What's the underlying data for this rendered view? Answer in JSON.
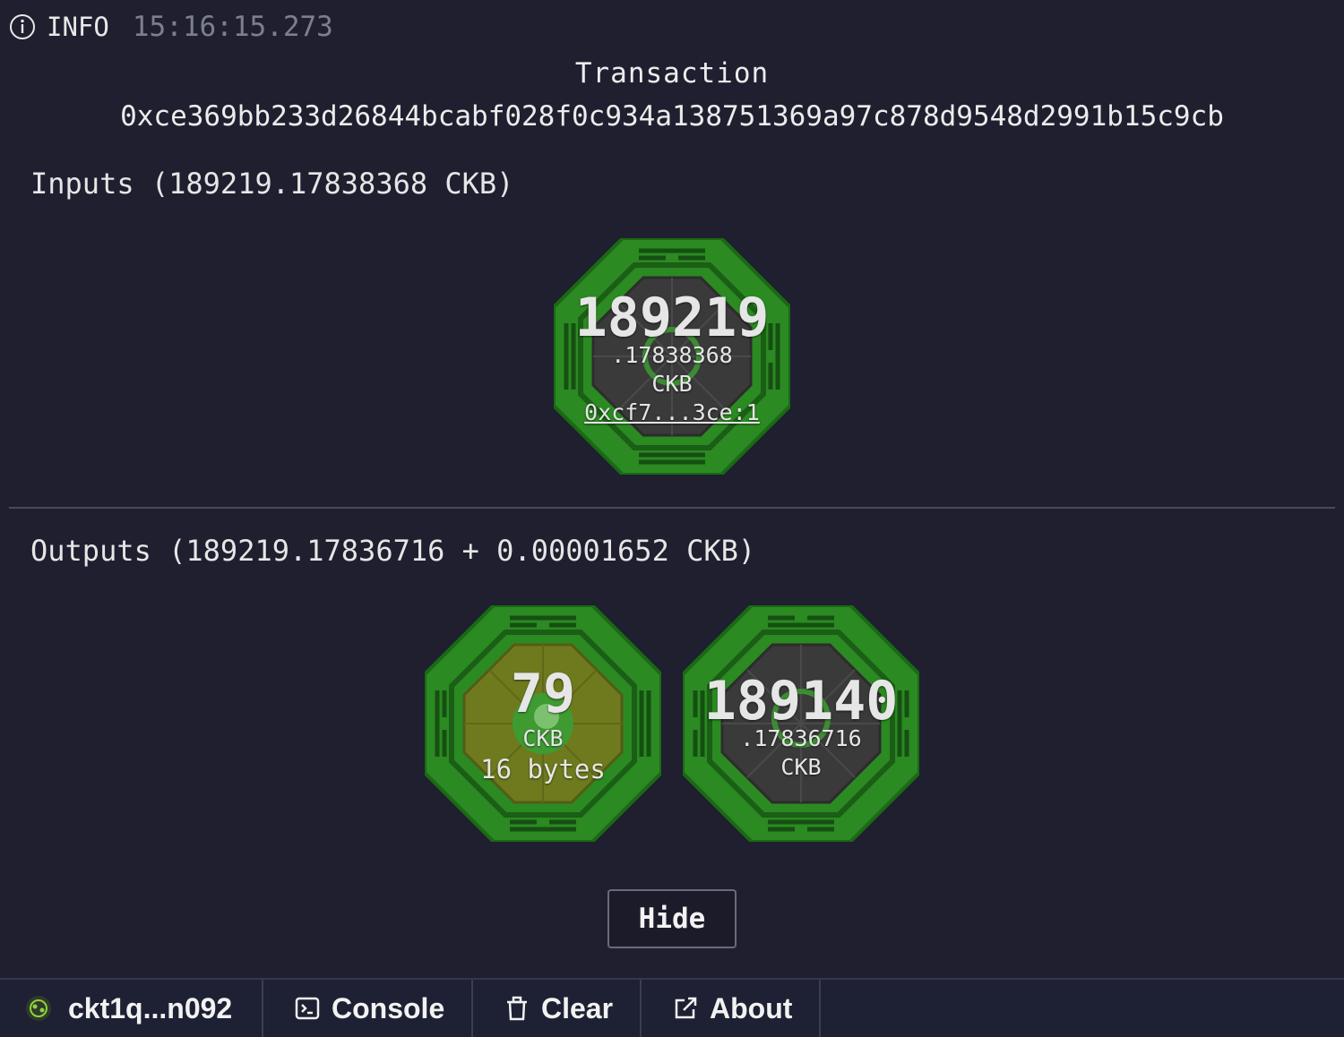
{
  "log": {
    "level": "INFO",
    "time": "15:16:15.273",
    "icon": "info-icon"
  },
  "transaction": {
    "title": "Transaction",
    "hash": "0xce369bb233d26844bcabf028f0c934a138751369a97c878d9548d2991b15c9cb"
  },
  "inputs": {
    "heading": "Inputs (189219.17838368 CKB)",
    "cells": [
      {
        "integer": "189219",
        "fraction": ".17838368",
        "unit": "CKB",
        "outpoint": "0xcf7...3ce:1",
        "core_color": "#3a3a3a"
      }
    ]
  },
  "outputs": {
    "heading": "Outputs (189219.17836716 + 0.00001652 CKB)",
    "cells": [
      {
        "integer": "79",
        "unit": "CKB",
        "data_size": "16 bytes",
        "core_color": "#6f7a1e"
      },
      {
        "integer": "189140",
        "fraction": ".17836716",
        "unit": "CKB",
        "core_color": "#3a3a3a"
      }
    ]
  },
  "hide_label": "Hide",
  "bottom_bar": {
    "account": "ckt1q...n092",
    "console": "Console",
    "clear": "Clear",
    "about": "About"
  },
  "colors": {
    "background": "#1f1f30",
    "cell_green": "#2b8a22",
    "cell_border": "#1a6a14"
  }
}
